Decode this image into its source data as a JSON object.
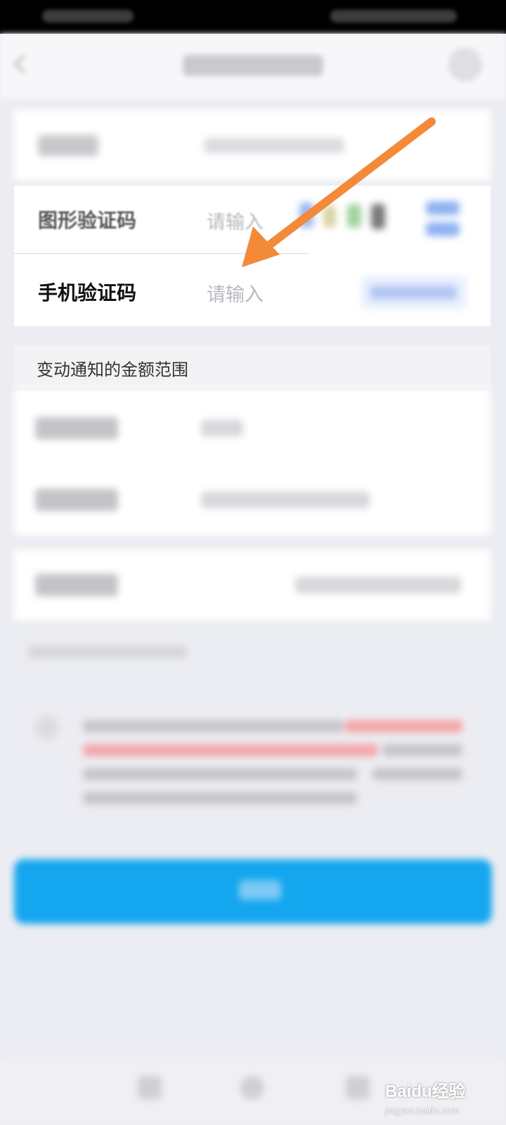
{
  "form": {
    "captcha_label": "图形验证码",
    "captcha_placeholder": "请输入",
    "sms_label": "手机验证码",
    "sms_placeholder": "请输入"
  },
  "amount_section": {
    "header": "变动通知的金额范围"
  },
  "watermark": {
    "brand": "Baidu经验",
    "url": "jingyan.baidu.com"
  },
  "colors": {
    "accent": "#14a6ee",
    "annotation_arrow": "#f28a3a",
    "background": "#ecedf2"
  }
}
